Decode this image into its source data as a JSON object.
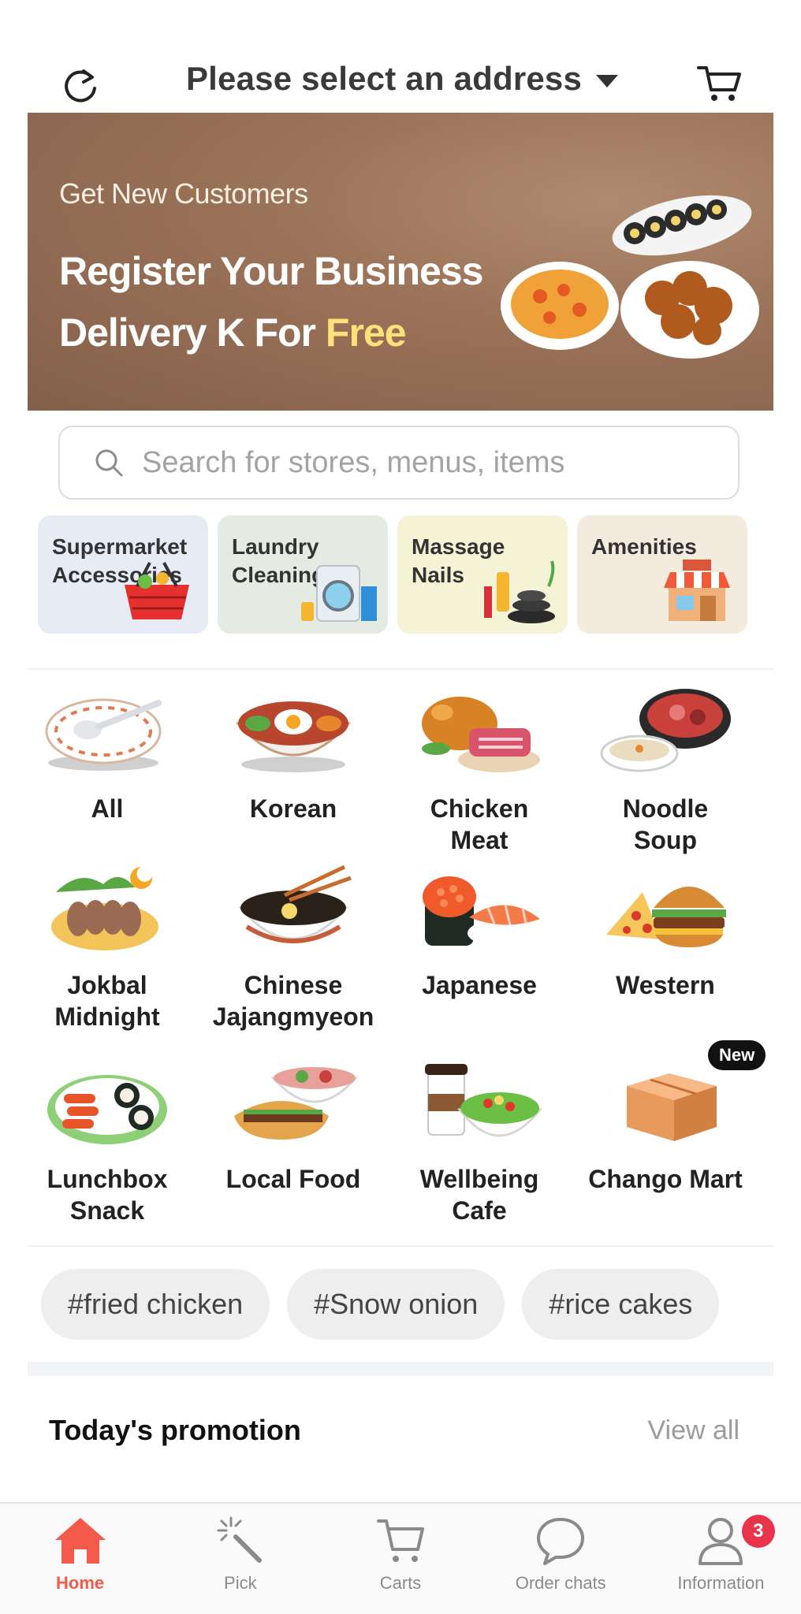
{
  "header": {
    "address_label": "Please select an address"
  },
  "banner": {
    "subtitle": "Get New Customers",
    "title_line1": "Register Your Business",
    "title_line2_prefix": "Delivery K For ",
    "title_line2_highlight": "Free"
  },
  "search": {
    "placeholder": "Search for stores, menus, items"
  },
  "services": [
    {
      "label": "Supermarket\nAccessories",
      "bg": "#e6ebf6",
      "icon": "shopping-basket-icon"
    },
    {
      "label": "Laundry\nCleaning",
      "bg": "#e5ebe3",
      "icon": "washing-machine-icon"
    },
    {
      "label": "Massage\nNails",
      "bg": "#f5f3d6",
      "icon": "cosmetics-icon"
    },
    {
      "label": "Amenities",
      "bg": "#f4ebdf",
      "icon": "store-icon"
    }
  ],
  "categories": [
    {
      "label": "All",
      "icon": "plate-spoon-icon"
    },
    {
      "label": "Korean",
      "icon": "bibimbap-icon"
    },
    {
      "label": "Chicken\nMeat",
      "icon": "roast-chicken-icon"
    },
    {
      "label": "Noodle\nSoup",
      "icon": "hotpot-icon"
    },
    {
      "label": "Jokbal\nMidnight",
      "icon": "jokbal-icon"
    },
    {
      "label": "Chinese\nJajangmyeon",
      "icon": "noodle-bowl-icon"
    },
    {
      "label": "Japanese",
      "icon": "sushi-icon"
    },
    {
      "label": "Western",
      "icon": "burger-pizza-icon"
    },
    {
      "label": "Lunchbox\nSnack",
      "icon": "tteokbokki-icon"
    },
    {
      "label": "Local Food",
      "icon": "banh-mi-icon"
    },
    {
      "label": "Wellbeing\nCafe",
      "icon": "coffee-salad-icon"
    },
    {
      "label": "Chango Mart",
      "icon": "boxes-icon",
      "badge": "New"
    }
  ],
  "tags": [
    "#fried chicken",
    "#Snow onion",
    "#rice cakes"
  ],
  "promotion": {
    "title": "Today's promotion",
    "view_all": "View all"
  },
  "nav": [
    {
      "label": "Home",
      "icon": "home-icon",
      "active": true
    },
    {
      "label": "Pick",
      "icon": "magic-wand-icon"
    },
    {
      "label": "Carts",
      "icon": "cart-icon"
    },
    {
      "label": "Order chats",
      "icon": "chat-icon"
    },
    {
      "label": "Information",
      "icon": "user-icon",
      "badge": "3"
    }
  ],
  "colors": {
    "accent": "#f45a4a",
    "highlight": "#ffe07a",
    "badge": "#e8344a"
  }
}
